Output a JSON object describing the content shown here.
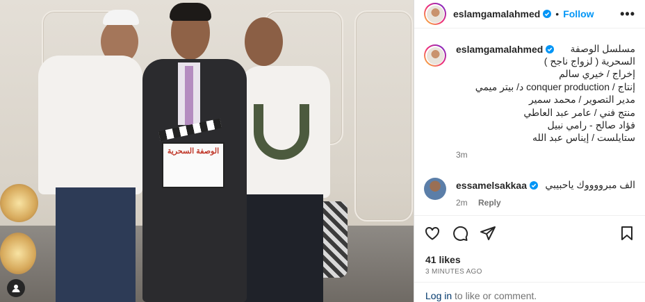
{
  "post": {
    "username": "eslamgamalahmed",
    "follow_label": "Follow",
    "separator": "•",
    "more_label": "•••",
    "clapper_title": "الوصفة السحرية"
  },
  "caption": {
    "username": "eslamgamalahmed",
    "lines": [
      "مسلسل الوصفة",
      "السحرية ( لزواج ناجح )",
      "إخراج / خيري سالم",
      "إنتاج / conquer production د/ بيتر ميمي",
      "مدير التصوير / محمد سمير",
      "منتج فني / عامر عبد العاطي",
      "فؤاد صالح - رامي نبيل",
      "ستايلست / إيناس عبد الله"
    ],
    "time": "3m"
  },
  "comment": {
    "username": "essamelsakkaa",
    "text": "الف مبرووووك ياحبيبي",
    "time": "2m",
    "reply_label": "Reply"
  },
  "engagement": {
    "likes": "41 likes",
    "posted_ago": "3 MINUTES AGO"
  },
  "footer": {
    "login_link": "Log in",
    "login_rest": " to like or comment."
  },
  "colors": {
    "accent": "#0095f6",
    "verified": "#0095f6",
    "muted": "#737373"
  }
}
